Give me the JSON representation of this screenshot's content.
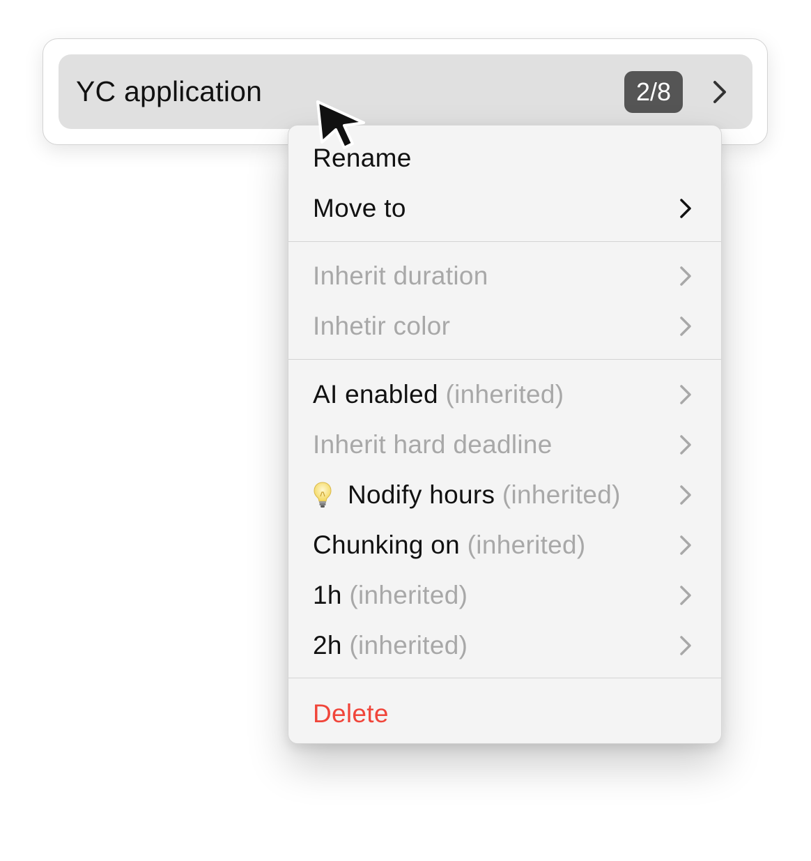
{
  "row": {
    "title": "YC application",
    "badge": "2/8"
  },
  "menu": {
    "rename": "Rename",
    "move_to": "Move to",
    "inherit_duration": "Inherit duration",
    "inherit_color": "Inhetir color",
    "ai_enabled": "AI enabled",
    "ai_enabled_suffix": "(inherited)",
    "inherit_hard_deadline": "Inherit hard deadline",
    "nodify_hours": "Nodify hours",
    "nodify_hours_suffix": "(inherited)",
    "chunking_on": "Chunking on",
    "chunking_on_suffix": "(inherited)",
    "one_hour": "1h",
    "one_hour_suffix": "(inherited)",
    "two_hour": "2h",
    "two_hour_suffix": "(inherited)",
    "delete": "Delete"
  },
  "icons": {
    "chevron": "chevron-right-icon",
    "bulb": "lightbulb-icon",
    "cursor": "mouse-pointer-icon"
  },
  "colors": {
    "danger": "#f0453a",
    "muted": "#a8a8a8",
    "badge_bg": "#555555",
    "row_bg": "#e0e0e0",
    "menu_bg": "#f4f4f4"
  }
}
